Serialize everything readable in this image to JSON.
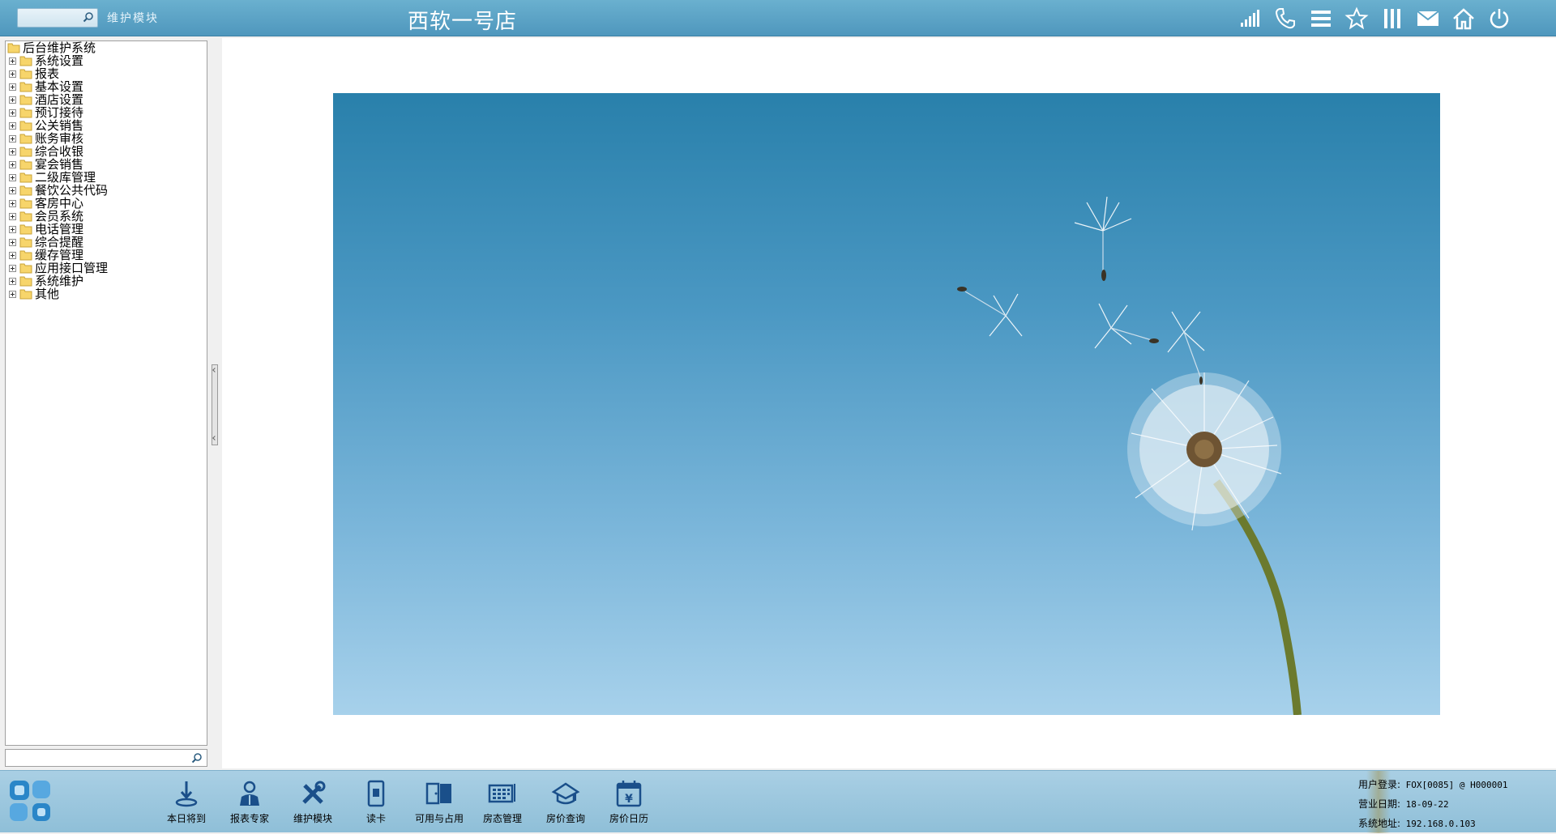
{
  "topbar": {
    "search_placeholder": "",
    "module_label": "维护模块",
    "store_title": "西软一号店",
    "icons": [
      "signal-icon",
      "phone-icon",
      "menu-icon",
      "star-icon",
      "columns-icon",
      "mail-icon",
      "house-icon",
      "power-icon"
    ]
  },
  "tree": {
    "root": "后台维护系统",
    "items": [
      {
        "label": "系统设置"
      },
      {
        "label": "报表"
      },
      {
        "label": "基本设置"
      },
      {
        "label": "酒店设置"
      },
      {
        "label": "预订接待"
      },
      {
        "label": "公关销售"
      },
      {
        "label": "账务审核"
      },
      {
        "label": "综合收银"
      },
      {
        "label": "宴会销售"
      },
      {
        "label": "二级库管理"
      },
      {
        "label": "餐饮公共代码"
      },
      {
        "label": "客房中心"
      },
      {
        "label": "会员系统"
      },
      {
        "label": "电话管理"
      },
      {
        "label": "综合提醒"
      },
      {
        "label": "缓存管理"
      },
      {
        "label": "应用接口管理"
      },
      {
        "label": "系统维护"
      },
      {
        "label": "其他"
      }
    ],
    "search_placeholder": ""
  },
  "taskbar": {
    "items": [
      {
        "label": "本日将到",
        "icon": "arrival-icon"
      },
      {
        "label": "报表专家",
        "icon": "report-expert-icon"
      },
      {
        "label": "维护模块",
        "icon": "tools-icon"
      },
      {
        "label": "读卡",
        "icon": "card-reader-icon"
      },
      {
        "label": "可用与占用",
        "icon": "availability-icon"
      },
      {
        "label": "房态管理",
        "icon": "room-status-icon"
      },
      {
        "label": "房价查询",
        "icon": "rate-query-icon"
      },
      {
        "label": "房价日历",
        "icon": "rate-calendar-icon"
      }
    ]
  },
  "status": {
    "user_label": "用户登录:",
    "user_value": "FOX[0085] @ H000001",
    "date_label": "营业日期:",
    "date_value": "18-09-22",
    "addr_label": "系统地址:",
    "addr_value": "192.168.0.103"
  },
  "colors": {
    "topbar": "#5aa3c6",
    "bottombar": "#9fc8df",
    "accent_dark": "#1a4f8a"
  }
}
